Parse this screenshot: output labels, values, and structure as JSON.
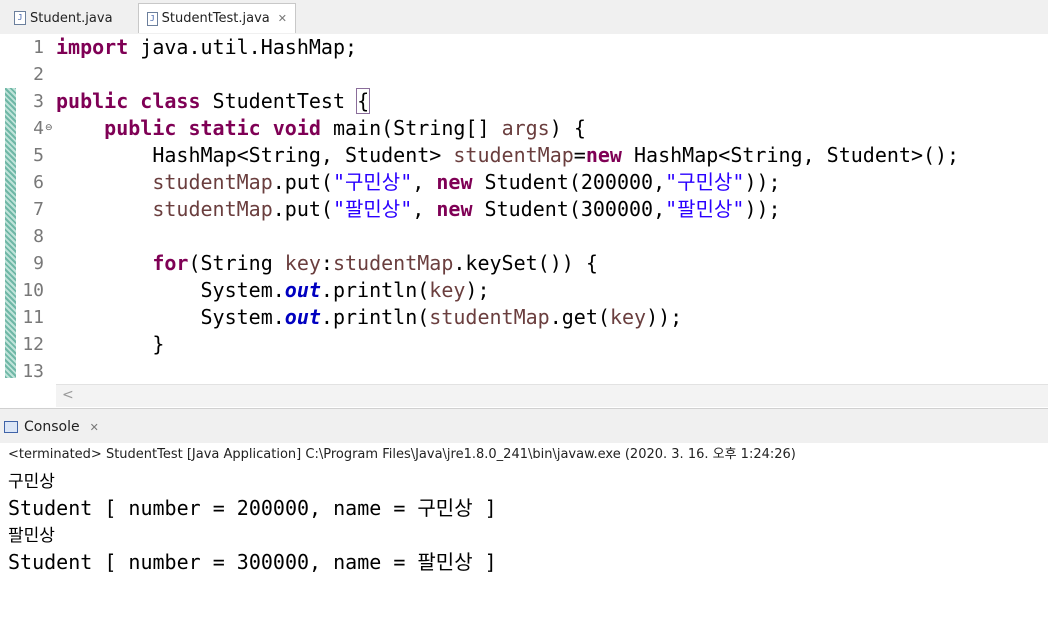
{
  "editor_tabs": [
    {
      "label": "Student.java",
      "active": false
    },
    {
      "label": "StudentTest.java",
      "active": true,
      "close": "✕"
    }
  ],
  "code": {
    "line_numbers": [
      "1",
      "2",
      "3",
      "4",
      "5",
      "6",
      "7",
      "8",
      "9",
      "10",
      "11",
      "12",
      "13"
    ],
    "l1": {
      "kw": "import",
      "rest": " java.util.HashMap;"
    },
    "l3": {
      "kw1": "public",
      "kw2": "class",
      "name": " StudentTest ",
      "brace": "{"
    },
    "l4": {
      "indent": "    ",
      "kw1": "public",
      "kw2": "static",
      "kw3": "void",
      "sig": " main(String[] ",
      "arg": "args",
      "end": ") {"
    },
    "l5": {
      "indent": "        ",
      "type": "HashMap<String, Student> ",
      "var": "studentMap",
      "eq": "=",
      "kw": "new",
      "rest": " HashMap<String, Student>();"
    },
    "l6": {
      "indent": "        ",
      "var": "studentMap",
      "put": ".put(",
      "s1": "\"구민상\"",
      "comma": ", ",
      "kw": "new",
      "ctor": " Student(200000,",
      "s2": "\"구민상\"",
      "end": "));"
    },
    "l7": {
      "indent": "        ",
      "var": "studentMap",
      "put": ".put(",
      "s1": "\"팔민상\"",
      "comma": ", ",
      "kw": "new",
      "ctor": " Student(300000,",
      "s2": "\"팔민상\"",
      "end": "));"
    },
    "l9": {
      "indent": "        ",
      "kw": "for",
      "p1": "(String ",
      "v1": "key",
      "colon": ":",
      "v2": "studentMap",
      "rest": ".keySet()) {"
    },
    "l10": {
      "indent": "            ",
      "cls": "System.",
      "fld": "out",
      "call": ".println(",
      "v": "key",
      "end": ");"
    },
    "l11": {
      "indent": "            ",
      "cls": "System.",
      "fld": "out",
      "call": ".println(",
      "v1": "studentMap",
      "get": ".get(",
      "v2": "key",
      "end": "));"
    },
    "l12": {
      "indent": "        ",
      "brace": "}"
    }
  },
  "hscroll_arrow": "<",
  "console": {
    "tab_label": "Console",
    "tab_close": "✕",
    "status": "<terminated> StudentTest [Java Application] C:\\Program Files\\Java\\jre1.8.0_241\\bin\\javaw.exe (2020. 3. 16. 오후 1:24:26)",
    "output": [
      "구민상",
      "Student [ number = 200000, name = 구민상 ]",
      "팔민상",
      "Student [ number = 300000, name = 팔민상 ]"
    ]
  },
  "colors": {
    "keyword": "#7f0055",
    "string": "#2a00ff",
    "variable": "#6a3e3e",
    "field": "#0000c0"
  }
}
